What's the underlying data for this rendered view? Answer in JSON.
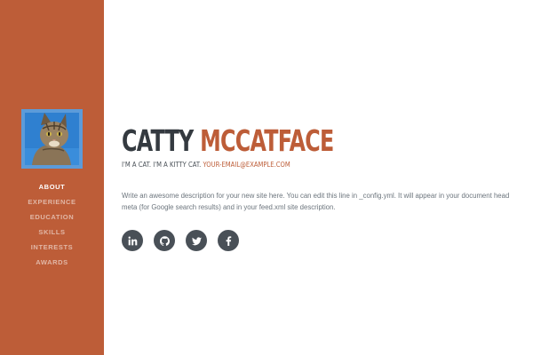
{
  "profile": {
    "avatar_alt": "cat-photo",
    "first_name": "CATTY",
    "last_name": "MCCATFACE",
    "subtitle": "I'M A CAT. I'M A KITTY CAT.",
    "email": "YOUR-EMAIL@EXAMPLE.COM",
    "description": "Write an awesome description for your new site here. You can edit this line in _config.yml. It will appear in your document head meta (for Google search results) and in your feed.xml site description."
  },
  "nav": {
    "items": [
      {
        "label": "ABOUT",
        "active": true
      },
      {
        "label": "EXPERIENCE",
        "active": false
      },
      {
        "label": "EDUCATION",
        "active": false
      },
      {
        "label": "SKILLS",
        "active": false
      },
      {
        "label": "INTERESTS",
        "active": false
      },
      {
        "label": "AWARDS",
        "active": false
      }
    ]
  },
  "social": [
    {
      "icon": "linkedin-icon"
    },
    {
      "icon": "github-icon"
    },
    {
      "icon": "twitter-icon"
    },
    {
      "icon": "facebook-icon"
    }
  ],
  "colors": {
    "primary": "#bd5d38",
    "dark": "#343a40",
    "muted": "#6c757d",
    "icon_bg": "#495057"
  }
}
